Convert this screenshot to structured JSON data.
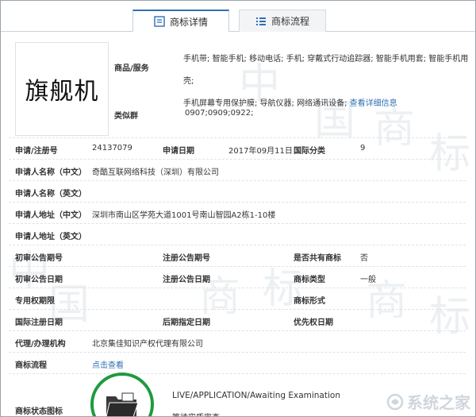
{
  "tabs": [
    {
      "label": "商标详情"
    },
    {
      "label": "商标流程"
    }
  ],
  "logo_text": "旗舰机",
  "goods_services": {
    "label": "商品/服务",
    "line1": "手机带; 智能手机; 移动电话; 手机; 穿戴式行动追踪器; 智能手机用套; 智能手机用壳;",
    "line2": "手机屏幕专用保护膜; 导航仪器; 网络通讯设备;",
    "detail_link": "查看详细信息"
  },
  "similar_group": {
    "label": "类似群",
    "value": "0907;0909;0922;"
  },
  "fields": {
    "reg_no_label": "申请/注册号",
    "reg_no": "24137079",
    "app_date_label": "申请日期",
    "app_date": "2017年09月11日",
    "intl_class_label": "国际分类",
    "intl_class": "9",
    "applicant_cn_label": "申请人名称（中文）",
    "applicant_cn": "奇酷互联网络科技（深圳）有限公司",
    "applicant_en_label": "申请人名称（英文）",
    "address_cn_label": "申请人地址（中文）",
    "address_cn": "深圳市南山区学苑大道1001号南山智园A2栋1-10楼",
    "address_en_label": "申请人地址（英文）",
    "prelim_no_label": "初审公告期号",
    "reg_pub_no_label": "注册公告期号",
    "shared_label": "是否共有商标",
    "shared": "否",
    "prelim_date_label": "初审公告日期",
    "reg_pub_date_label": "注册公告日期",
    "type_label": "商标类型",
    "type": "一般",
    "exclusive_label": "专用权期限",
    "form_label": "商标形式",
    "intl_reg_date_label": "国际注册日期",
    "later_date_label": "后期指定日期",
    "priority_date_label": "优先权日期",
    "agency_label": "代理/办理机构",
    "agency": "北京集佳知识产权代理有限公司",
    "flow_label": "商标流程",
    "flow_link": "点击查看",
    "status_icon_label": "商标状态图标",
    "status_text": "LIVE/APPLICATION/Awaiting Examination",
    "status_cn": "等待实质审查"
  },
  "watermark": {
    "char1": "中",
    "char2": "国",
    "char3": "商",
    "char4": "标"
  },
  "site_watermark": "系统之家",
  "colors": {
    "accent": "#2f6fb5",
    "status_green": "#1e9a3f"
  }
}
